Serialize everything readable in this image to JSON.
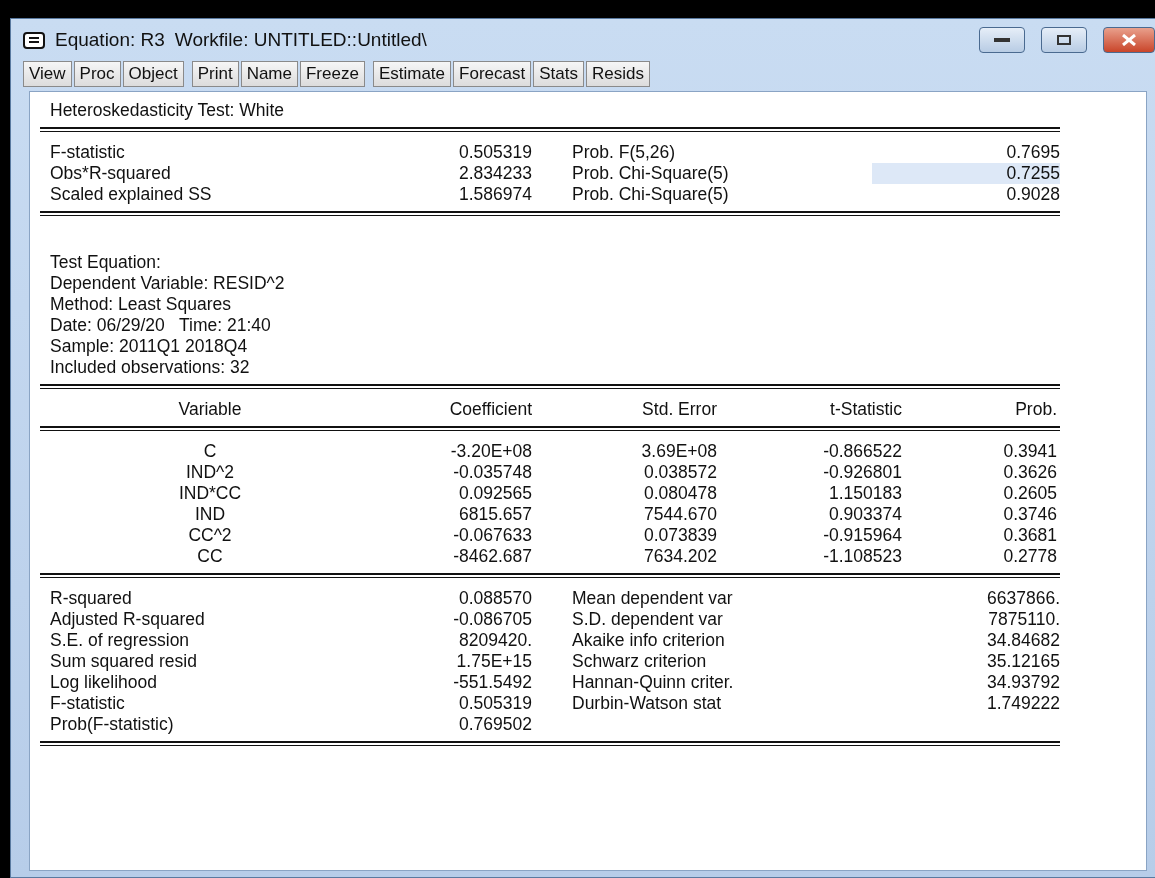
{
  "window": {
    "title": "Equation: R3",
    "workfile": "Workfile: UNTITLED::Untitled\\"
  },
  "toolbar": [
    {
      "buttons": [
        "View",
        "Proc",
        "Object"
      ]
    },
    {
      "buttons": [
        "Print",
        "Name",
        "Freeze"
      ]
    },
    {
      "buttons": [
        "Estimate",
        "Forecast",
        "Stats",
        "Resids"
      ]
    }
  ],
  "output": {
    "test_title": "Heteroskedasticity Test: White",
    "test_stats": [
      {
        "label": "F-statistic",
        "value": "0.505319",
        "prob_label": "Prob. F(5,26)",
        "prob": "0.7695",
        "selected": false
      },
      {
        "label": "Obs*R-squared",
        "value": "2.834233",
        "prob_label": "Prob. Chi-Square(5)",
        "prob": "0.7255",
        "selected": true
      },
      {
        "label": "Scaled explained SS",
        "value": "1.586974",
        "prob_label": "Prob. Chi-Square(5)",
        "prob": "0.9028",
        "selected": false
      }
    ],
    "info": [
      "Test Equation:",
      "Dependent Variable: RESID^2",
      "Method: Least Squares",
      "Date: 06/29/20   Time: 21:40",
      "Sample: 2011Q1 2018Q4",
      "Included observations: 32"
    ],
    "columns": [
      "Variable",
      "Coefficient",
      "Std. Error",
      "t-Statistic",
      "Prob."
    ],
    "rows": [
      [
        "C",
        "-3.20E+08",
        "3.69E+08",
        "-0.866522",
        "0.3941"
      ],
      [
        "IND^2",
        "-0.035748",
        "0.038572",
        "-0.926801",
        "0.3626"
      ],
      [
        "IND*CC",
        "0.092565",
        "0.080478",
        "1.150183",
        "0.2605"
      ],
      [
        "IND",
        "6815.657",
        "7544.670",
        "0.903374",
        "0.3746"
      ],
      [
        "CC^2",
        "-0.067633",
        "0.073839",
        "-0.915964",
        "0.3681"
      ],
      [
        "CC",
        "-8462.687",
        "7634.202",
        "-1.108523",
        "0.2778"
      ]
    ],
    "summary": [
      {
        "label": "R-squared",
        "value": "0.088570",
        "label_2": "Mean dependent var",
        "value_2": "6637866."
      },
      {
        "label": "Adjusted R-squared",
        "value": "-0.086705",
        "label_2": "S.D. dependent var",
        "value_2": "7875110."
      },
      {
        "label": "S.E. of regression",
        "value": "8209420.",
        "label_2": "Akaike info criterion",
        "value_2": "34.84682"
      },
      {
        "label": "Sum squared resid",
        "value": "1.75E+15",
        "label_2": "Schwarz criterion",
        "value_2": "35.12165"
      },
      {
        "label": "Log likelihood",
        "value": "-551.5492",
        "label_2": "Hannan-Quinn criter.",
        "value_2": "34.93792"
      },
      {
        "label": "F-statistic",
        "value": "0.505319",
        "label_2": "Durbin-Watson stat",
        "value_2": "1.749222"
      },
      {
        "label": "Prob(F-statistic)",
        "value": "0.769502"
      }
    ]
  }
}
